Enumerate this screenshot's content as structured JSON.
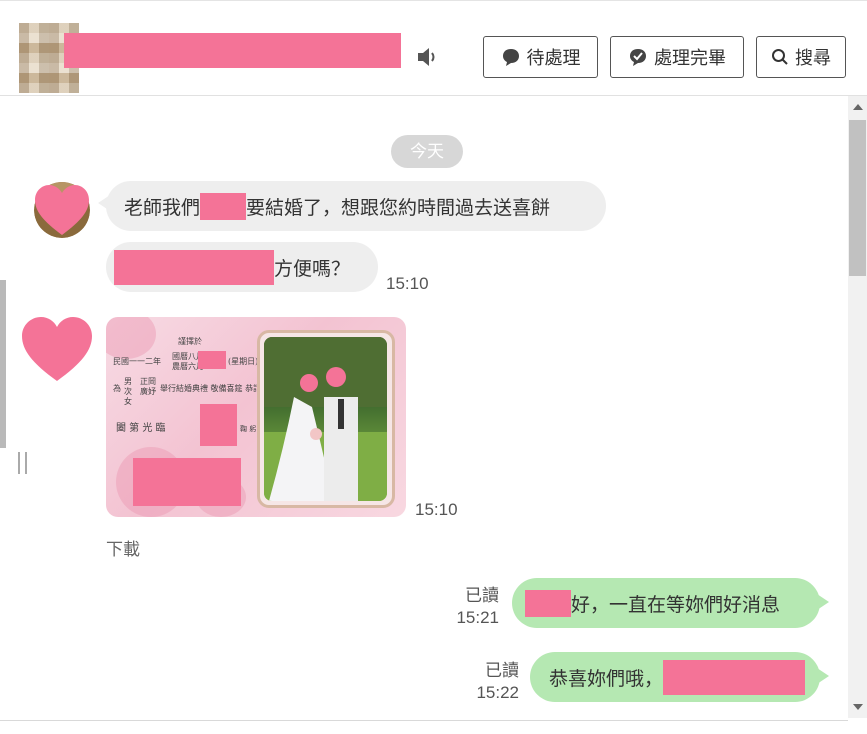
{
  "header": {
    "buttons": {
      "pending": "待處理",
      "done": "處理完畢",
      "search": "搜尋"
    },
    "icons": [
      "speaker-icon",
      "chat-bubble-icon",
      "check-bubble-icon",
      "search-icon"
    ]
  },
  "chat": {
    "date_label": "今天",
    "messages": [
      {
        "dir": "in",
        "text_before": "老師我們",
        "text_after": "要結婚了，想跟您約時間過去送喜餅"
      },
      {
        "dir": "in",
        "text_after": "方便嗎？",
        "time": "15:10"
      },
      {
        "dir": "in",
        "type": "image",
        "time": "15:10",
        "download": "下載",
        "invite_text": {
          "line1": "謹擇於",
          "line2": "民國一一二年",
          "cal1": "國曆",
          "cal2": "農曆",
          "month1": "八月",
          "month2": "六月",
          "weekday": "(星期日)",
          "for": "為",
          "roles": "男次 女",
          "names": "正岡 廣妤",
          "ceremony": "舉行結婚典禮 敬備喜筵 恭請",
          "bow": "鞠 躬",
          "family": "闔 第 光 臨"
        }
      },
      {
        "dir": "out",
        "text_after": "好，一直在等妳們好消息",
        "read": "已讀",
        "time": "15:21"
      },
      {
        "dir": "out",
        "text_before": "恭喜妳們哦，",
        "read": "已讀",
        "time": "15:22"
      }
    ]
  },
  "colors": {
    "redaction": "#f47397",
    "incoming_bubble": "#eeeeee",
    "outgoing_bubble": "#b5e8b2",
    "date_pill": "#d7d7d7"
  }
}
